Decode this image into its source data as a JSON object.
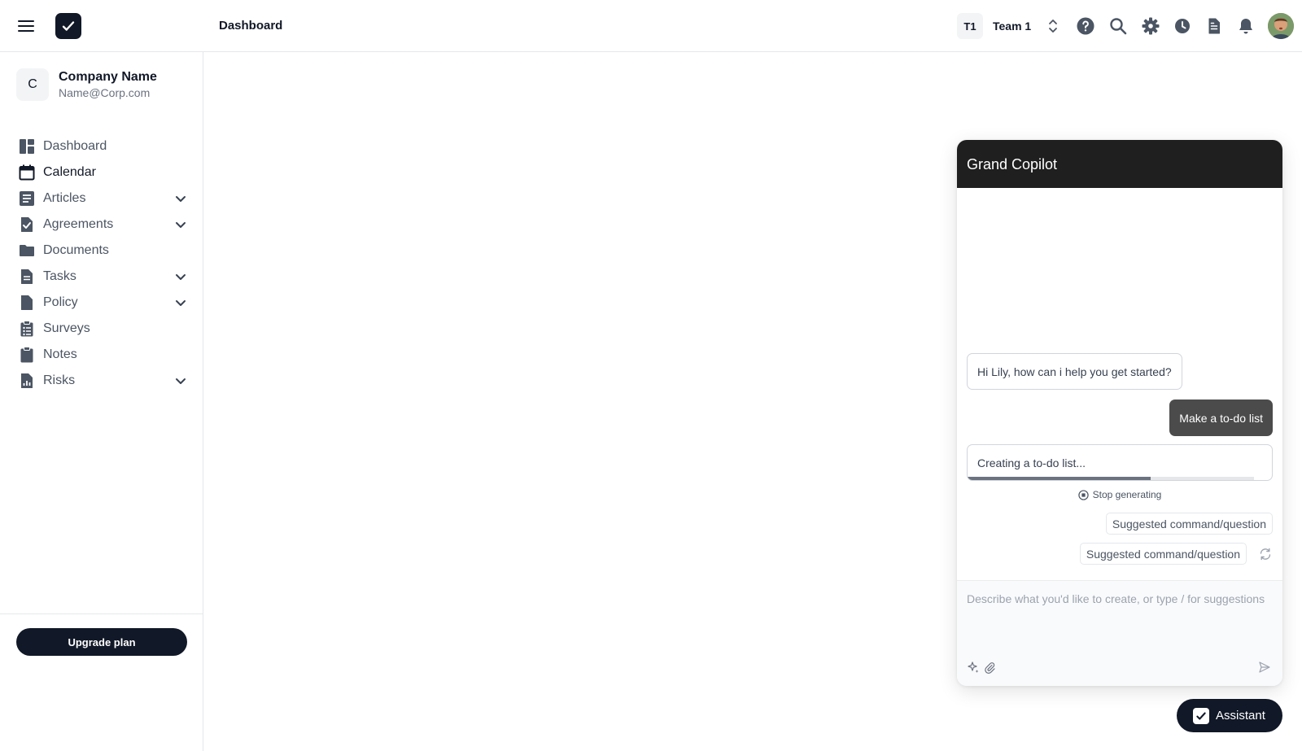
{
  "header": {
    "title": "Dashboard",
    "team_badge": "T1",
    "team_name": "Team 1",
    "icons": [
      "menu-icon",
      "app-logo",
      "help-icon",
      "search-icon",
      "gear-icon",
      "clock-icon",
      "document-icon",
      "bell-icon",
      "avatar"
    ]
  },
  "sidebar": {
    "company": {
      "initial": "C",
      "name": "Company Name",
      "email": "Name@Corp.com"
    },
    "items": [
      {
        "label": "Dashboard",
        "icon": "dashboard-icon",
        "expandable": false
      },
      {
        "label": "Calendar",
        "icon": "calendar-icon",
        "expandable": false,
        "active": true
      },
      {
        "label": "Articles",
        "icon": "articles-icon",
        "expandable": true
      },
      {
        "label": "Agreements",
        "icon": "agreement-icon",
        "expandable": true
      },
      {
        "label": "Documents",
        "icon": "folder-icon",
        "expandable": false
      },
      {
        "label": "Tasks",
        "icon": "tasks-icon",
        "expandable": true
      },
      {
        "label": "Policy",
        "icon": "policy-icon",
        "expandable": true
      },
      {
        "label": "Surveys",
        "icon": "survey-icon",
        "expandable": false
      },
      {
        "label": "Notes",
        "icon": "notes-icon",
        "expandable": false
      },
      {
        "label": "Risks",
        "icon": "risks-icon",
        "expandable": true
      }
    ],
    "upgrade_label": "Upgrade plan"
  },
  "copilot": {
    "title": "Grand Copilot",
    "bot_message": "Hi Lily, how can i help you get started?",
    "user_message": "Make a to-do list",
    "progress_text": "Creating a to-do list...",
    "progress_fraction": 0.64,
    "stop_label": "Stop generating",
    "suggestions": [
      "Suggested command/question",
      "Suggested command/question"
    ],
    "input_placeholder": "Describe what you'd like to create, or type / for suggestions"
  },
  "assistant": {
    "label": "Assistant"
  },
  "colors": {
    "primary_dark": "#111827",
    "copilot_header": "#1f1f1f",
    "user_bubble": "#4b4b4b",
    "muted_text": "#6b7280"
  }
}
